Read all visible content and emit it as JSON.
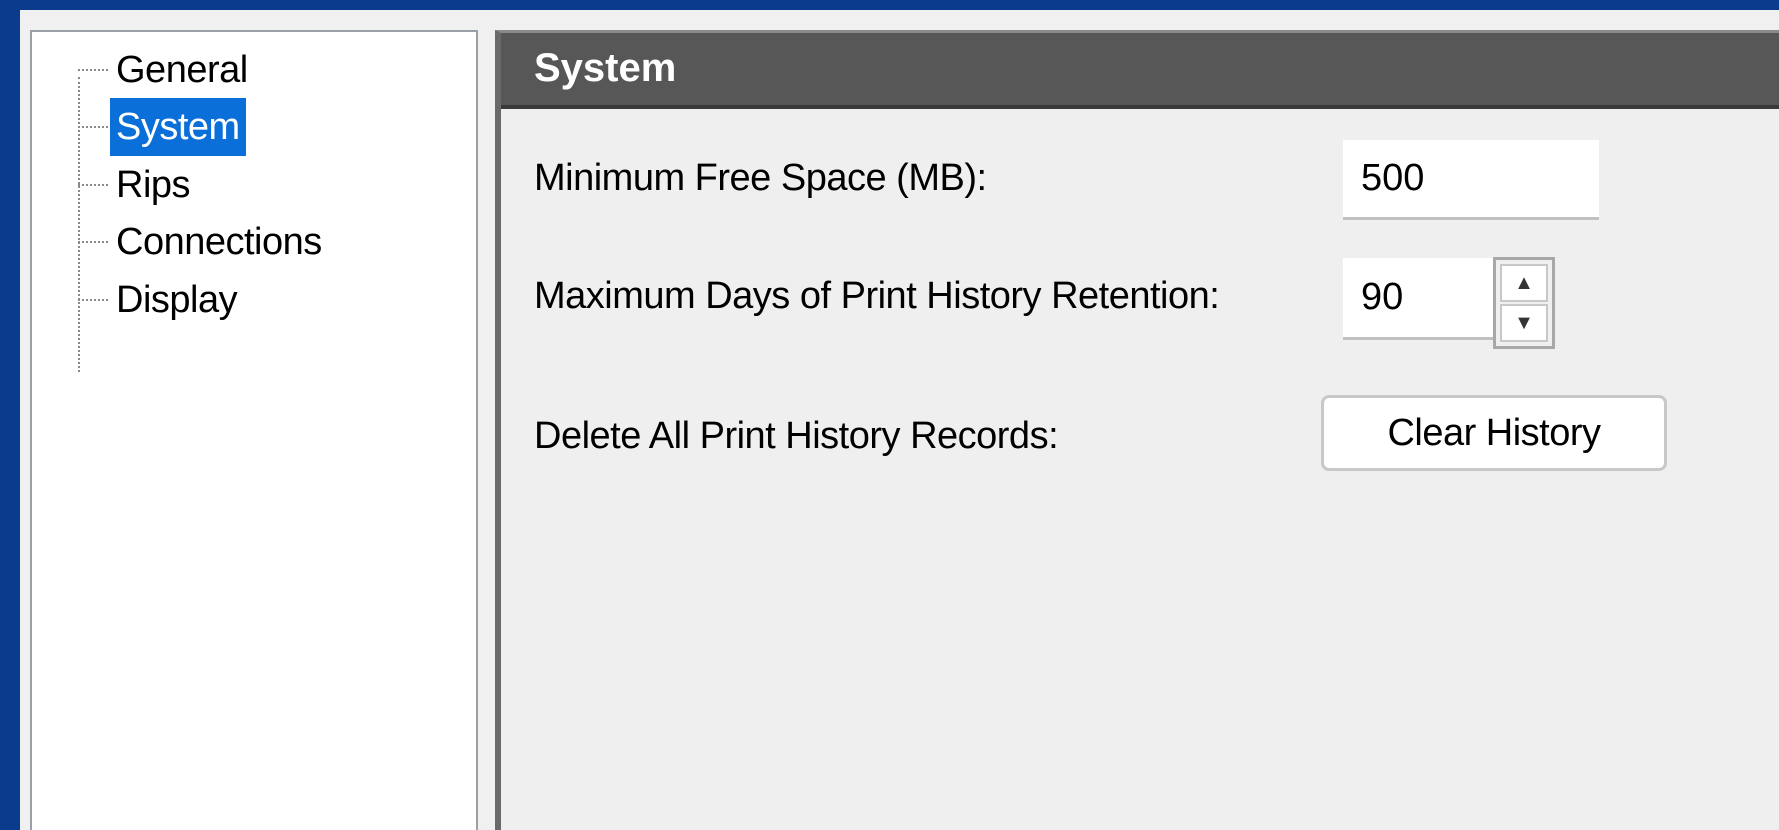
{
  "tree": {
    "items": [
      {
        "label": "General"
      },
      {
        "label": "System"
      },
      {
        "label": "Rips"
      },
      {
        "label": "Connections"
      },
      {
        "label": "Display"
      }
    ],
    "selected": "System"
  },
  "panel": {
    "title": "System",
    "min_free_space": {
      "label": "Minimum Free Space (MB):",
      "value": "500"
    },
    "max_days": {
      "label": "Maximum Days of Print History Retention:",
      "value": "90",
      "up_icon": "triangle-up",
      "down_icon": "triangle-down"
    },
    "delete_history": {
      "label": "Delete All Print History Records:",
      "button_label": "Clear History"
    }
  },
  "colors": {
    "window_border": "#0b3b8c",
    "selection": "#0a6fd8",
    "header_bg": "#575757"
  }
}
